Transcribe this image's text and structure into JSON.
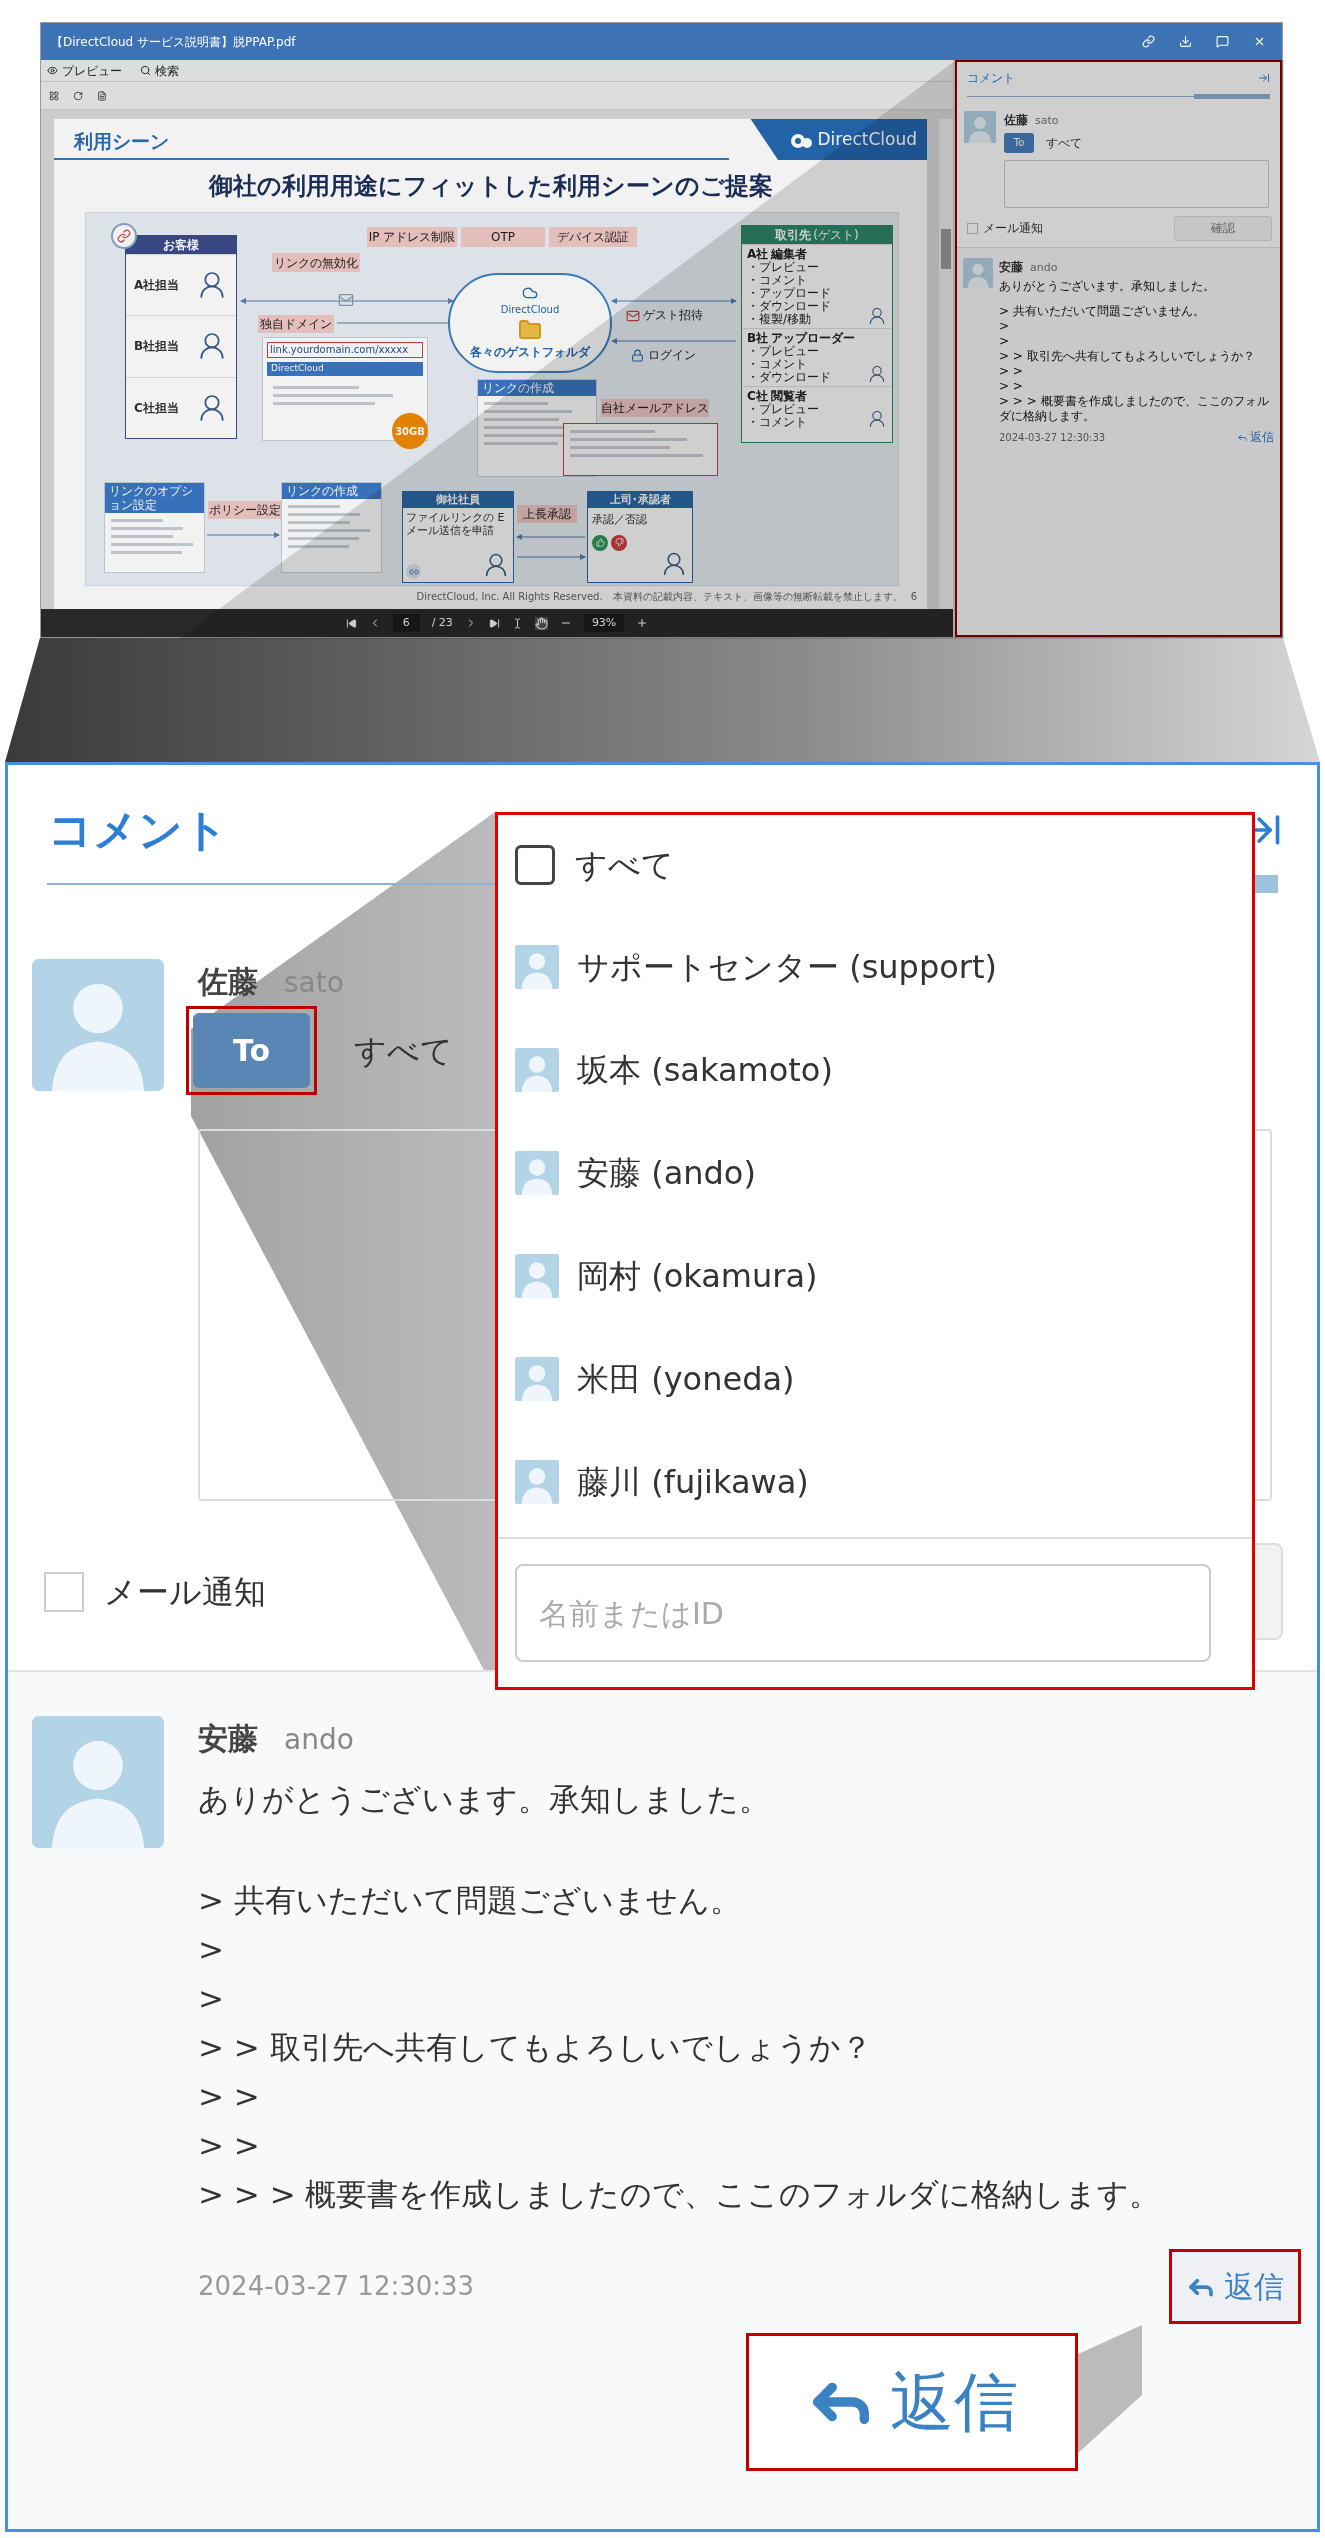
{
  "window": {
    "title": "【DirectCloud サービス説明書】脱PPAP.pdf",
    "toolbar": [
      {
        "kind": "preview",
        "label": "プレビュー"
      },
      {
        "kind": "search",
        "label": "検索"
      }
    ],
    "slide": {
      "section": "利用シーン",
      "logo": "DirectCloud",
      "headline": "御社の利用用途にフィットした利用シーンのご提案",
      "customer": {
        "title": "お客様",
        "members": [
          "A社担当",
          "B社担当",
          "C社担当"
        ]
      },
      "callouts": [
        "リンクの無効化",
        "IP アドレス制限",
        "OTP",
        "デバイス認証",
        "独自ドメイン",
        "自社メールアドレス",
        "ポリシー設定",
        "上長承認"
      ],
      "domain_preview": {
        "url": "link.yourdomain.com/xxxxx",
        "brand": "DirectCloud",
        "badge": "30GB"
      },
      "cloud": {
        "brand": "DirectCloud",
        "caption": "各々のゲストフォルダ"
      },
      "guest_flow": [
        "ゲスト招待",
        "ログイン"
      ],
      "partners": {
        "title": "取引先",
        "note": "(ゲスト)",
        "companies": [
          {
            "name": "A社",
            "role": "編集者",
            "permissions": [
              "・プレビュー",
              "・コメント",
              "・アップロード",
              "・ダウンロード",
              "・複製/移動"
            ]
          },
          {
            "name": "B社",
            "role": "アップローダー",
            "permissions": [
              "・プレビュー",
              "・コメント",
              "・ダウンロード"
            ]
          },
          {
            "name": "C社",
            "role": "閲覧者",
            "permissions": [
              "・プレビュー",
              "・コメント"
            ]
          }
        ]
      },
      "screens": [
        "リンクの作成",
        "リンクのオプション設定",
        "リンクの作成"
      ],
      "employee": {
        "title": "御社社員",
        "text": "ファイルリンクの Eメール送信を申請"
      },
      "approver": {
        "title": "上司･承認者",
        "text": "承認／否認"
      },
      "footer": "DirectCloud, Inc. All Rights Reserved.　本資料の記載内容、テキスト、画像等の無断転載を禁止します。",
      "page_number": "6"
    },
    "page_nav": {
      "page": "6",
      "total": "/ 23",
      "zoom": "93%"
    },
    "comment_panel": {
      "title": "コメント",
      "composer": {
        "author": "佐藤",
        "user_id": "sato",
        "to_button": "To",
        "recipients": "すべて",
        "mail_notify": {
          "label": "メール通知",
          "checked": false
        },
        "submit": {
          "label": "確認",
          "disabled": true
        }
      },
      "comments": [
        {
          "author": "安藤",
          "user_id": "ando",
          "paragraphs": [
            [
              "ありがとうございます。承知しました。"
            ],
            [
              "> 共有いただいて問題ございません。",
              ">",
              ">",
              "> > 取引先へ共有してもよろしいでしょうか？",
              "> >",
              "> >",
              "> > > 概要書を作成しましたので、ここのフォルダに格納します。"
            ]
          ],
          "timestamp": "2024-03-27 12:30:33",
          "reply": "返信"
        }
      ]
    }
  },
  "zoomed_panel": {
    "title": "コメント",
    "composer": {
      "author": "佐藤",
      "user_id": "sato",
      "to_button": "To",
      "recipients": "すべて",
      "mail_notify": {
        "label": "メール通知",
        "checked": false
      }
    },
    "recipient_dropdown": {
      "select_all": {
        "label": "すべて",
        "checked": false
      },
      "members": [
        "サポートセンター (support)",
        "坂本 (sakamoto)",
        "安藤 (ando)",
        "岡村 (okamura)",
        "米田 (yoneda)",
        "藤川 (fujikawa)"
      ],
      "search": {
        "placeholder": "名前またはID"
      }
    },
    "comments": [
      {
        "author": "安藤",
        "user_id": "ando",
        "paragraphs": [
          [
            "ありがとうございます。承知しました。"
          ],
          [
            "> 共有いただいて問題ございません。",
            ">",
            ">",
            "> > 取引先へ共有してもよろしいでしょうか？",
            "> >",
            "> >",
            "> > > 概要書を作成しましたので、ここのフォルダに格納します。"
          ]
        ],
        "timestamp": "2024-03-27 12:30:33",
        "reply": "返信"
      }
    ]
  },
  "reply_callout": {
    "label": "返信"
  }
}
